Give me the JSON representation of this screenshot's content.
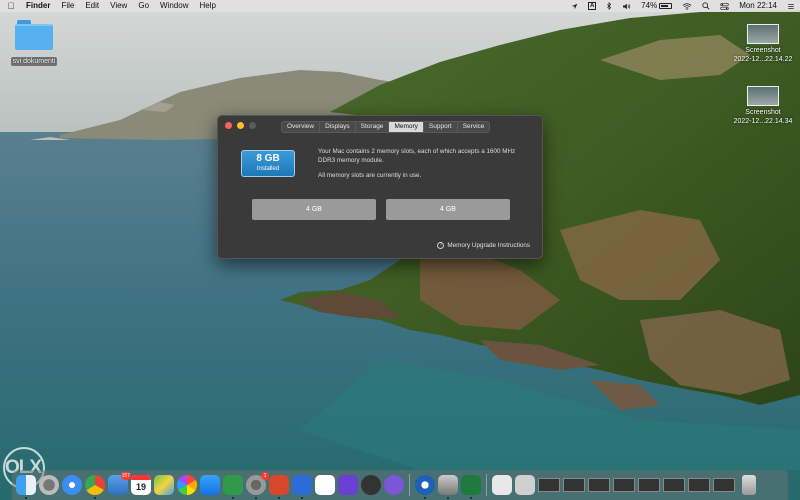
{
  "menubar": {
    "app_name": "Finder",
    "menus": [
      "File",
      "Edit",
      "View",
      "Go",
      "Window",
      "Help"
    ],
    "status": {
      "a_box": "A",
      "battery_pct": "74%",
      "battery_level": 0.74,
      "clock": "Mon 22:14"
    }
  },
  "desktop": {
    "folder_label": "svi dokumenti",
    "screenshots": [
      {
        "line1": "Screenshot",
        "line2": "2022-12...22.14.22"
      },
      {
        "line1": "Screenshot",
        "line2": "2022-12...22.14.34"
      }
    ]
  },
  "about_window": {
    "tabs": [
      "Overview",
      "Displays",
      "Storage",
      "Memory",
      "Support",
      "Service"
    ],
    "active_tab": "Memory",
    "badge_size": "8 GB",
    "badge_caption": "Installed",
    "description": "Your Mac contains 2 memory slots, each of which accepts a 1600 MHz DDR3 memory module.",
    "slot_status": "All memory slots are currently in use.",
    "slots": [
      "4 GB",
      "4 GB"
    ],
    "upgrade_link": "Memory Upgrade Instructions"
  },
  "dock": {
    "calendar_day": "19",
    "mail_badge": "",
    "settings_badge": "1"
  },
  "watermark": "OLX",
  "colors": {
    "accent_blue": "#2b89cc",
    "window_bg": "#3a3a3a",
    "close": "#ff5f57",
    "minimize": "#febc2e"
  }
}
